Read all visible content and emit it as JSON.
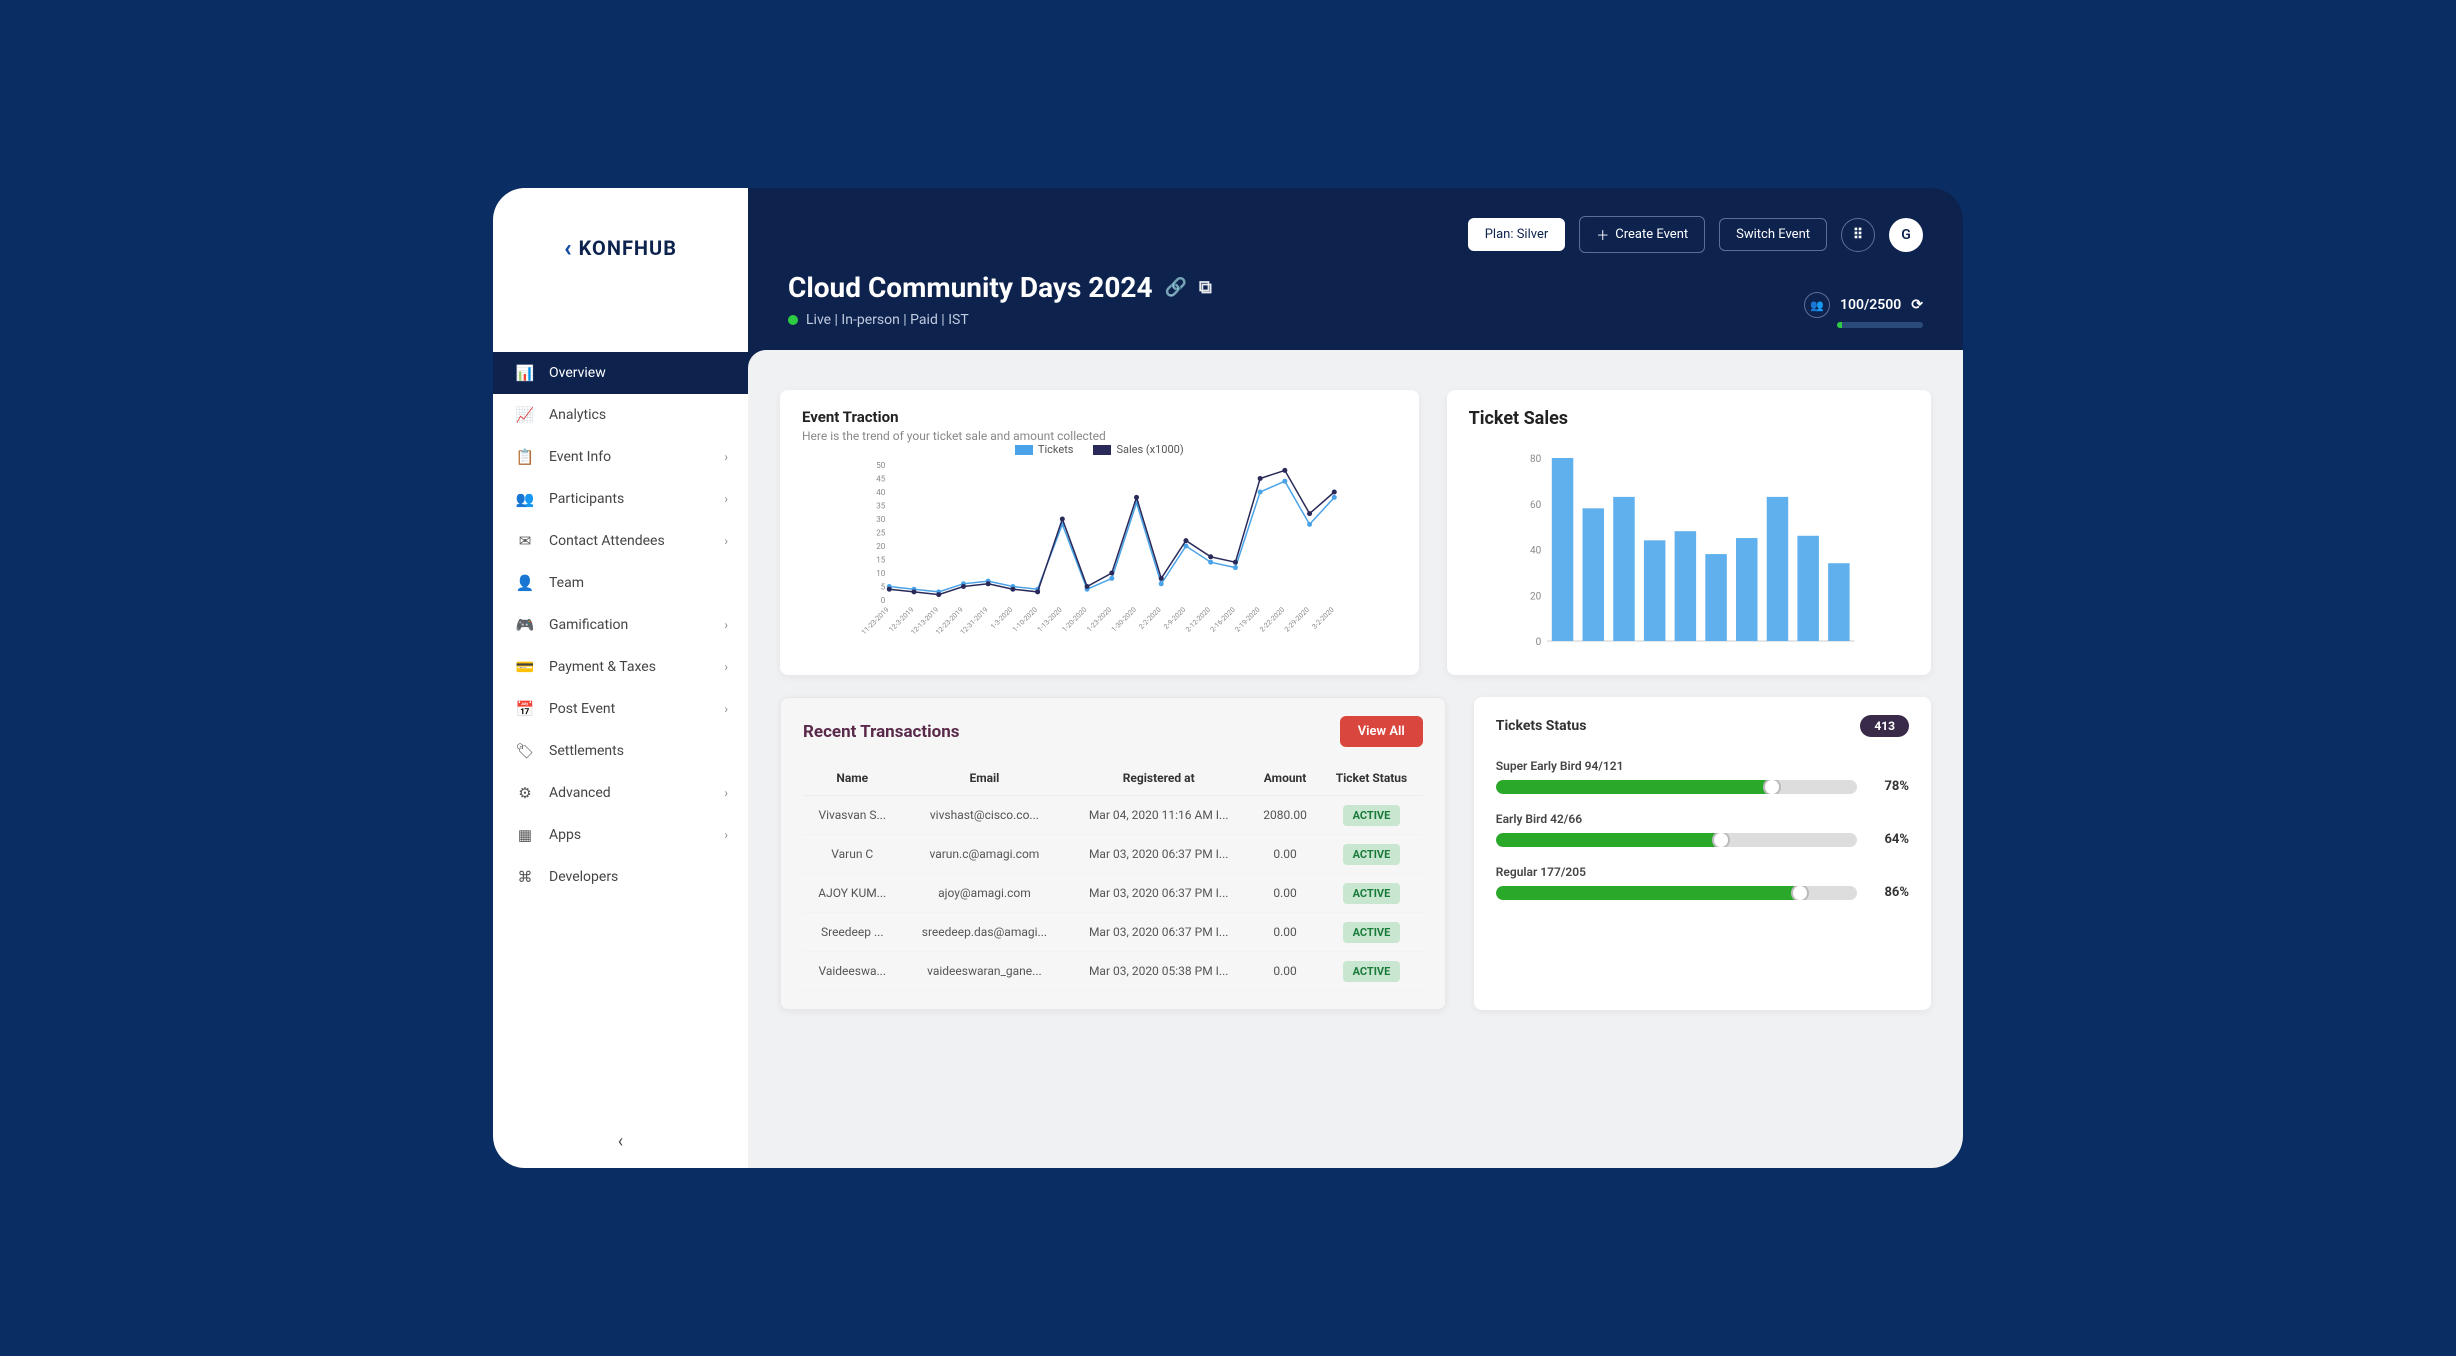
{
  "brand": "KONFHUB",
  "topbar": {
    "plan": "Plan: Silver",
    "create": "Create Event",
    "switch": "Switch Event",
    "avatar": "G"
  },
  "event": {
    "title": "Cloud Community Days 2024",
    "meta": "Live | In-person | Paid | IST",
    "capacity_text": "100/2500",
    "capacity_pct": 4
  },
  "sidebar": {
    "items": [
      {
        "label": "Overview",
        "icon": "📊",
        "active": true,
        "expandable": false
      },
      {
        "label": "Analytics",
        "icon": "📈",
        "active": false,
        "expandable": false
      },
      {
        "label": "Event Info",
        "icon": "📋",
        "active": false,
        "expandable": true
      },
      {
        "label": "Participants",
        "icon": "👥",
        "active": false,
        "expandable": true
      },
      {
        "label": "Contact Attendees",
        "icon": "✉",
        "active": false,
        "expandable": true
      },
      {
        "label": "Team",
        "icon": "👤",
        "active": false,
        "expandable": false
      },
      {
        "label": "Gamification",
        "icon": "🎮",
        "active": false,
        "expandable": true
      },
      {
        "label": "Payment & Taxes",
        "icon": "💳",
        "active": false,
        "expandable": true
      },
      {
        "label": "Post Event",
        "icon": "📅",
        "active": false,
        "expandable": true
      },
      {
        "label": "Settlements",
        "icon": "🏷",
        "active": false,
        "expandable": false
      },
      {
        "label": "Advanced",
        "icon": "⚙",
        "active": false,
        "expandable": true
      },
      {
        "label": "Apps",
        "icon": "▦",
        "active": false,
        "expandable": true
      },
      {
        "label": "Developers",
        "icon": "⌘",
        "active": false,
        "expandable": false
      }
    ]
  },
  "traction": {
    "title": "Event Traction",
    "subtitle": "Here is the trend of your ticket sale and amount collected",
    "legend_tickets": "Tickets",
    "legend_sales": "Sales (x1000)"
  },
  "sales": {
    "title": "Ticket Sales"
  },
  "tx": {
    "title": "Recent Transactions",
    "view_all": "View All",
    "headers": {
      "name": "Name",
      "email": "Email",
      "reg": "Registered at",
      "amount": "Amount",
      "status": "Ticket Status"
    },
    "rows": [
      {
        "name": "Vivasvan S...",
        "email": "vivshast@cisco.co...",
        "reg": "Mar 04, 2020 11:16 AM I...",
        "amount": "2080.00",
        "status": "ACTIVE"
      },
      {
        "name": "Varun C",
        "email": "varun.c@amagi.com",
        "reg": "Mar 03, 2020 06:37 PM I...",
        "amount": "0.00",
        "status": "ACTIVE"
      },
      {
        "name": "AJOY KUM...",
        "email": "ajoy@amagi.com",
        "reg": "Mar 03, 2020 06:37 PM I...",
        "amount": "0.00",
        "status": "ACTIVE"
      },
      {
        "name": "Sreedeep ...",
        "email": "sreedeep.das@amagi...",
        "reg": "Mar 03, 2020 06:37 PM I...",
        "amount": "0.00",
        "status": "ACTIVE"
      },
      {
        "name": "Vaideeswa...",
        "email": "vaideeswaran_gane...",
        "reg": "Mar 03, 2020 05:38 PM I...",
        "amount": "0.00",
        "status": "ACTIVE"
      }
    ]
  },
  "ticket_status": {
    "title": "Tickets Status",
    "count": "413",
    "rows": [
      {
        "label": "Super Early Bird 94/121",
        "pct": 78
      },
      {
        "label": "Early Bird 42/66",
        "pct": 64
      },
      {
        "label": "Regular 177/205",
        "pct": 86
      }
    ]
  },
  "chart_data": [
    {
      "type": "line",
      "title": "Event Traction",
      "ylabel": "",
      "ylim": [
        0,
        50
      ],
      "yticks": [
        0,
        5,
        10,
        15,
        20,
        25,
        30,
        35,
        40,
        45,
        50
      ],
      "categories": [
        "11-23-2019",
        "12-3-2019",
        "12-13-2019",
        "12-23-2019",
        "12-31-2019",
        "1-3-2020",
        "1-10-2020",
        "1-13-2020",
        "1-20-2020",
        "1-23-2020",
        "1-30-2020",
        "2-2-2020",
        "2-9-2020",
        "2-12-2020",
        "2-16-2020",
        "2-19-2020",
        "2-22-2020",
        "2-29-2020",
        "3-2-2020"
      ],
      "series": [
        {
          "name": "Tickets",
          "color": "#4aa3e8",
          "values": [
            5,
            4,
            3,
            6,
            7,
            5,
            4,
            28,
            4,
            8,
            36,
            6,
            20,
            14,
            12,
            40,
            44,
            28,
            38
          ]
        },
        {
          "name": "Sales (x1000)",
          "color": "#2a2a5a",
          "values": [
            4,
            3,
            2,
            5,
            6,
            4,
            3,
            30,
            5,
            10,
            38,
            8,
            22,
            16,
            14,
            45,
            48,
            32,
            40
          ]
        }
      ]
    },
    {
      "type": "bar",
      "title": "Ticket Sales",
      "ylim": [
        0,
        80
      ],
      "yticks": [
        0,
        20,
        40,
        60,
        80
      ],
      "categories": [
        "",
        "",
        "",
        "",
        "",
        "",
        "",
        "",
        "",
        ""
      ],
      "values": [
        85,
        58,
        63,
        44,
        48,
        38,
        45,
        63,
        46,
        34
      ],
      "color": "#5fb0ec"
    }
  ]
}
